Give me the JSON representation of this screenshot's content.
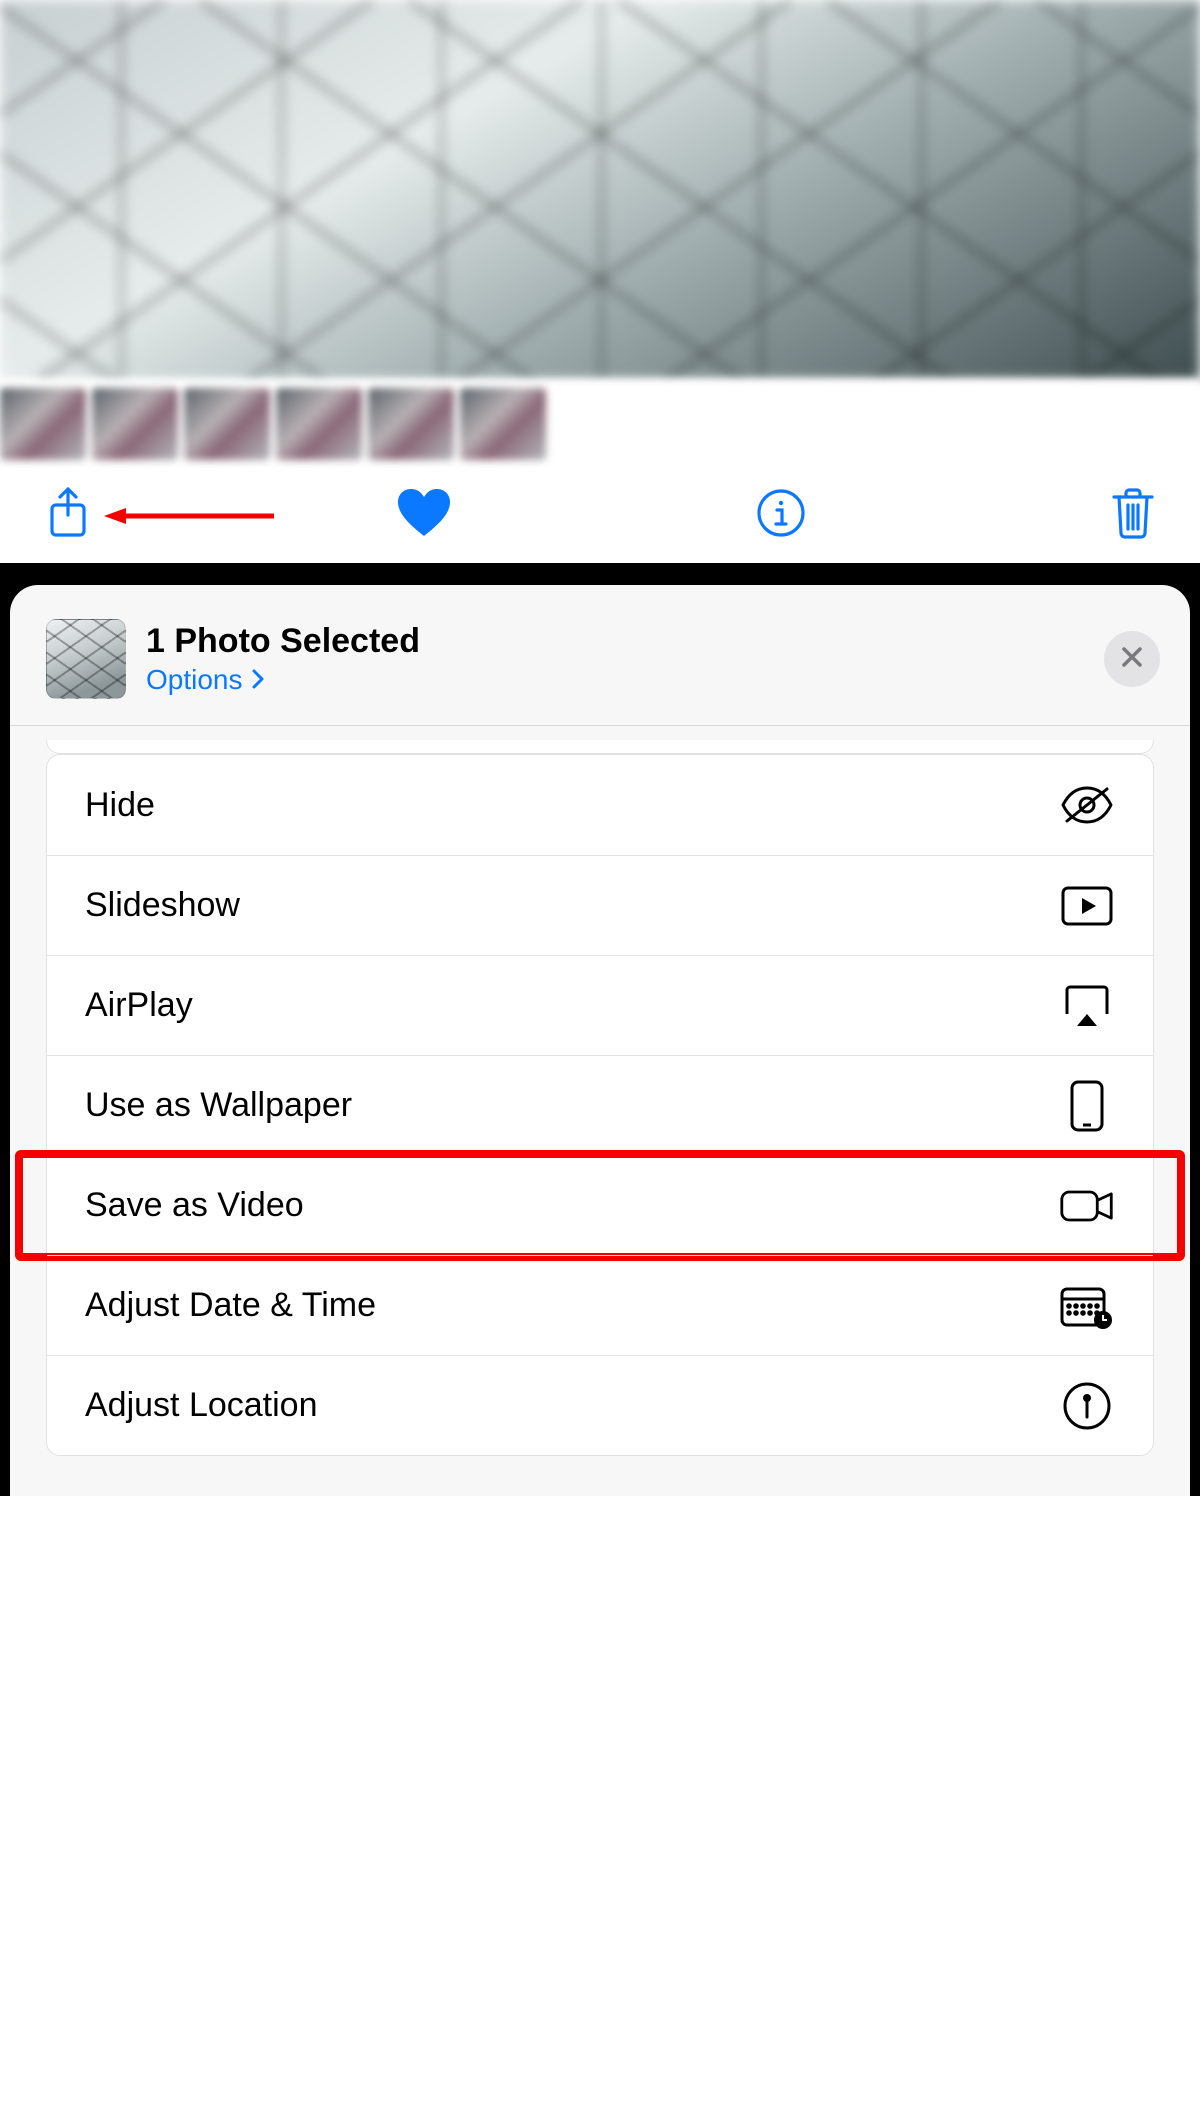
{
  "toolbar": {
    "share_icon": "share-icon",
    "favorite_icon": "heart-filled-icon",
    "info_icon": "info-circle-icon",
    "trash_icon": "trash-icon"
  },
  "annotation": {
    "arrow_target": "share-icon",
    "highlight_row": "save-as-video"
  },
  "sheet": {
    "title": "1 Photo Selected",
    "options_label": "Options",
    "close_label": "Close"
  },
  "actions": [
    {
      "id": "hide",
      "label": "Hide",
      "icon": "eye-slash-icon"
    },
    {
      "id": "slideshow",
      "label": "Slideshow",
      "icon": "play-rect-icon"
    },
    {
      "id": "airplay",
      "label": "AirPlay",
      "icon": "airplay-icon"
    },
    {
      "id": "use-as-wallpaper",
      "label": "Use as Wallpaper",
      "icon": "phone-icon"
    },
    {
      "id": "save-as-video",
      "label": "Save as Video",
      "icon": "video-icon"
    },
    {
      "id": "adjust-date-time",
      "label": "Adjust Date & Time",
      "icon": "calendar-clock-icon"
    },
    {
      "id": "adjust-location",
      "label": "Adjust Location",
      "icon": "pin-circle-icon"
    }
  ]
}
